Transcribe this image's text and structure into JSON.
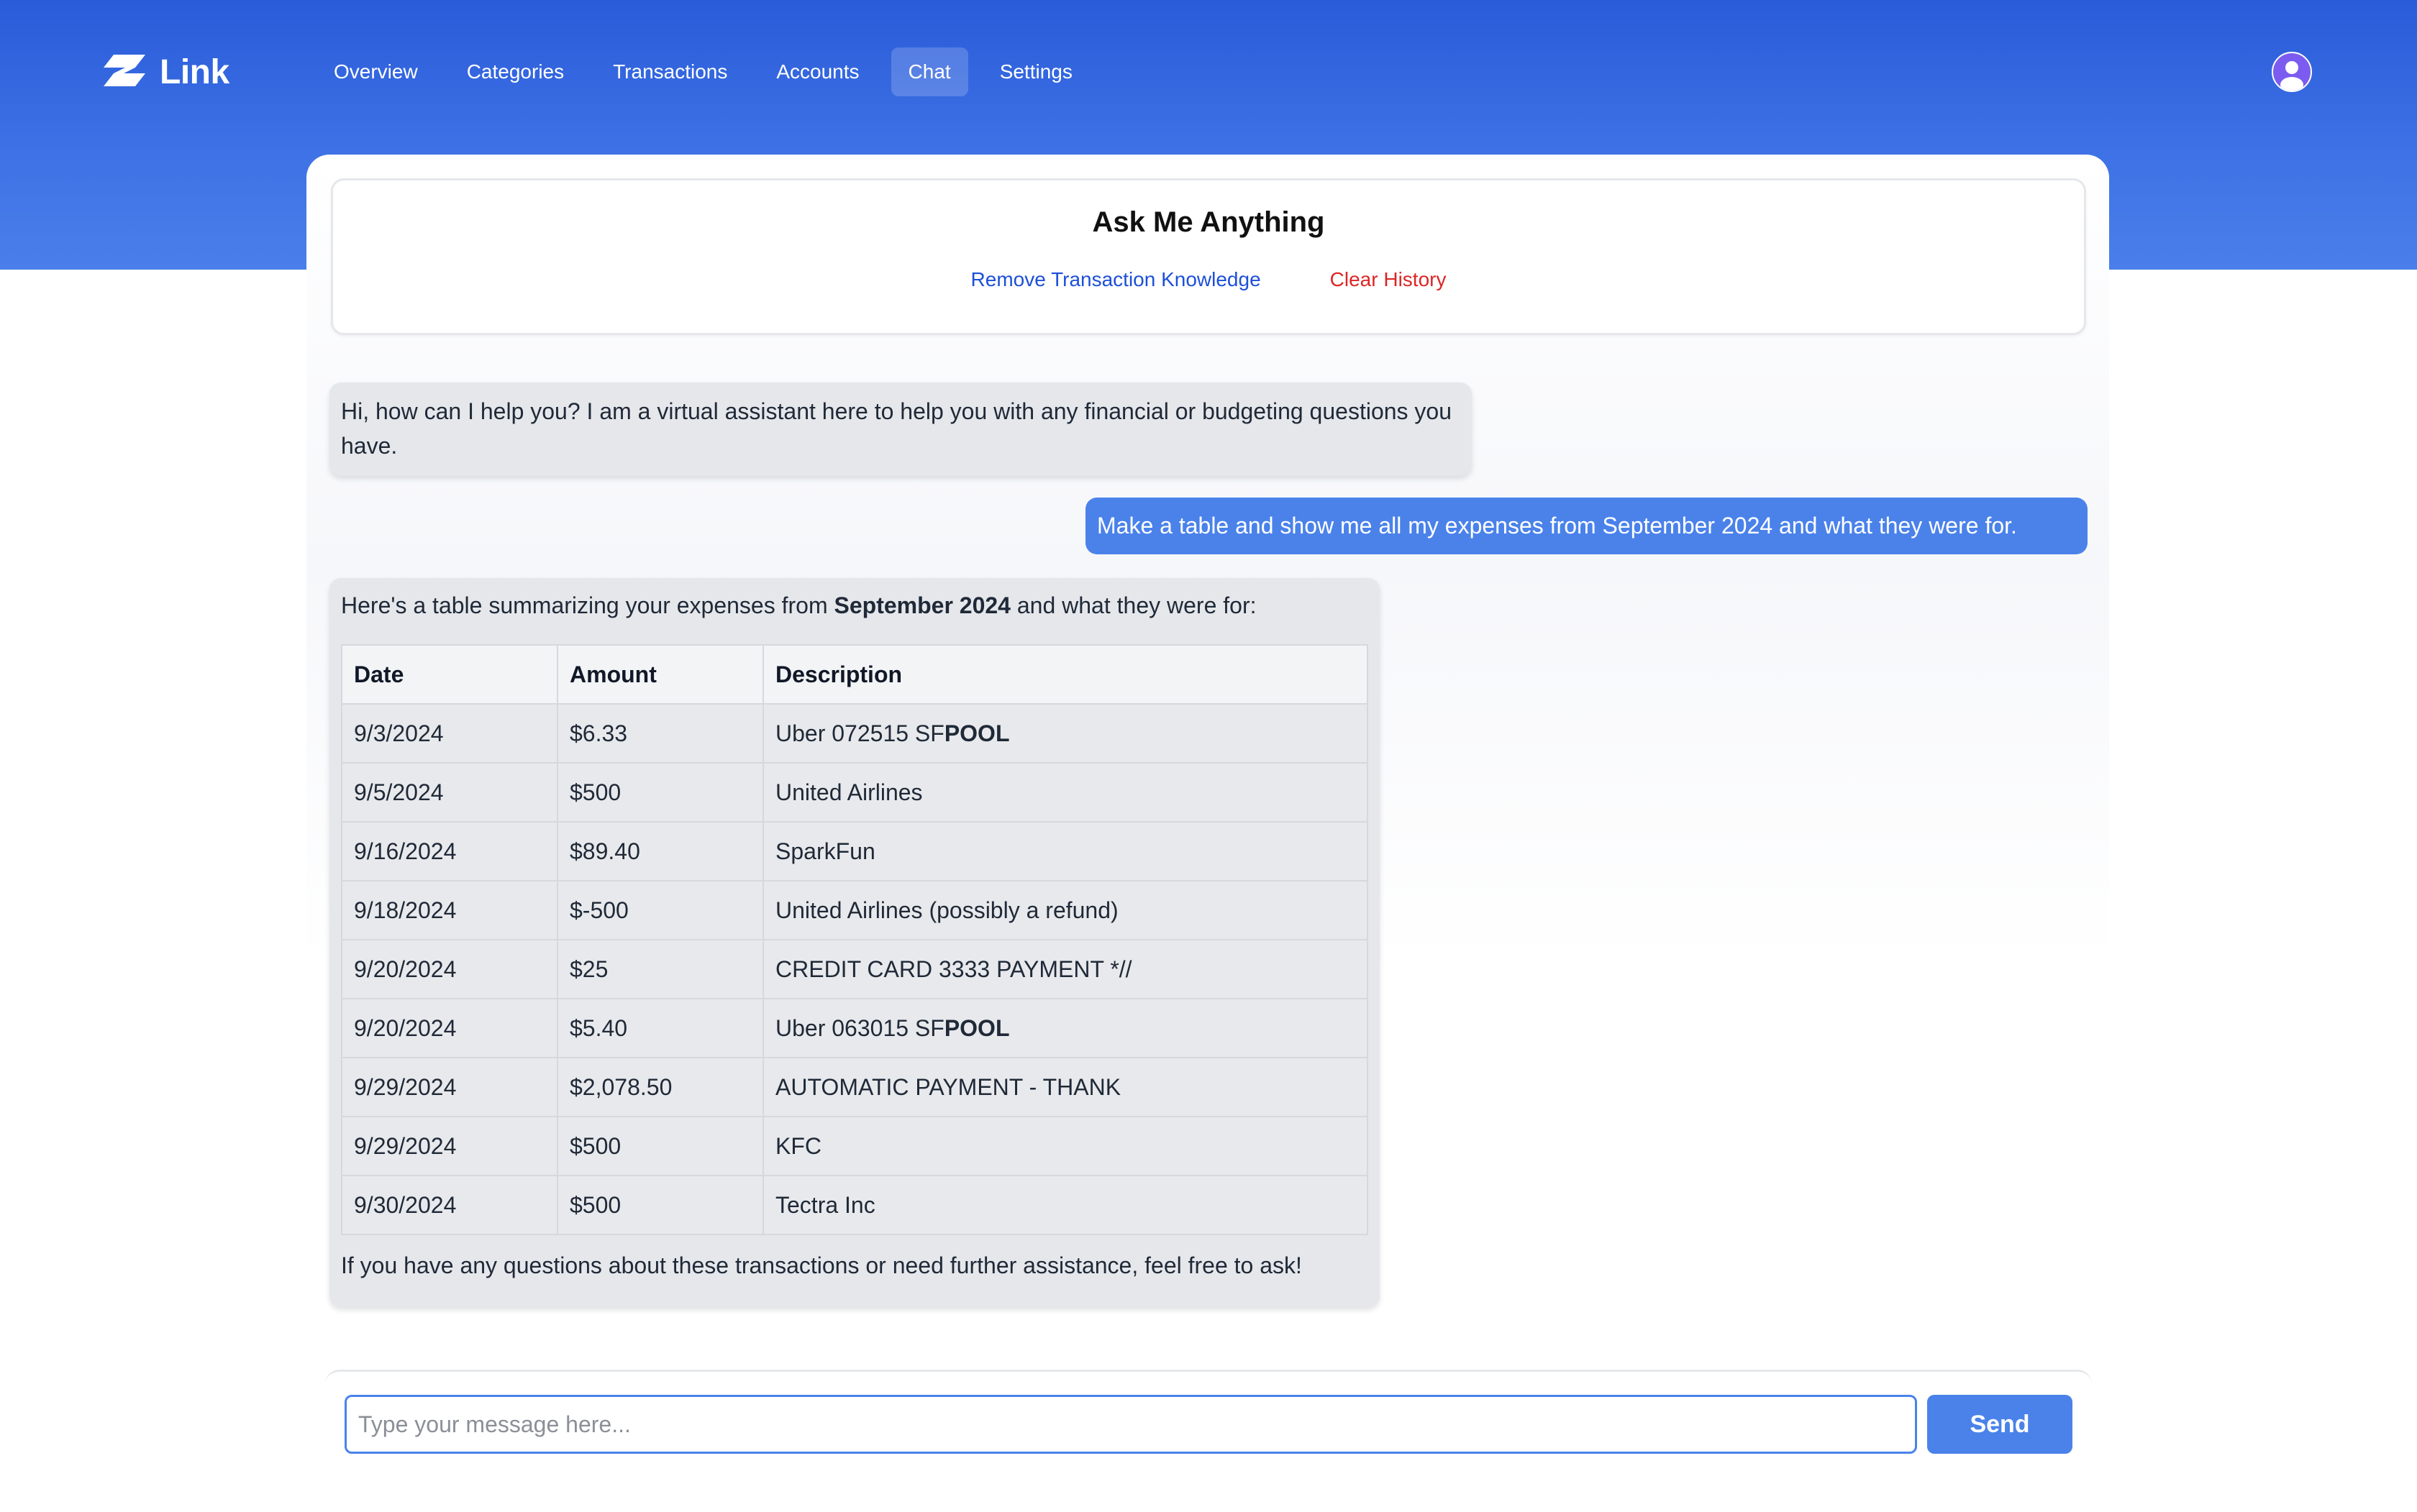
{
  "app": {
    "name": "Link"
  },
  "nav": {
    "items": [
      {
        "label": "Overview"
      },
      {
        "label": "Categories"
      },
      {
        "label": "Transactions"
      },
      {
        "label": "Accounts"
      },
      {
        "label": "Chat",
        "active": true
      },
      {
        "label": "Settings"
      }
    ]
  },
  "header": {
    "title": "Ask Me Anything",
    "remove_knowledge_label": "Remove Transaction Knowledge",
    "clear_history_label": "Clear History"
  },
  "messages": {
    "greeting": "Hi, how can I help you? I am a virtual assistant here to help you with any financial or budgeting questions you have.",
    "user_request": "Make a table and show me all my expenses from September 2024 and what they were for.",
    "reply": {
      "intro_before": "Here's a table summarizing your expenses from ",
      "intro_bold": "September 2024",
      "intro_after": " and what they were for:",
      "table": {
        "headers": [
          "Date",
          "Amount",
          "Description"
        ],
        "rows": [
          {
            "date": "9/3/2024",
            "amount": "$6.33",
            "desc": "Uber 072515 SF",
            "desc_bold": "POOL"
          },
          {
            "date": "9/5/2024",
            "amount": "$500",
            "desc": "United Airlines",
            "desc_bold": ""
          },
          {
            "date": "9/16/2024",
            "amount": "$89.40",
            "desc": "SparkFun",
            "desc_bold": ""
          },
          {
            "date": "9/18/2024",
            "amount": "$-500",
            "desc": "United Airlines (possibly a refund)",
            "desc_bold": ""
          },
          {
            "date": "9/20/2024",
            "amount": "$25",
            "desc": "CREDIT CARD 3333 PAYMENT *//",
            "desc_bold": ""
          },
          {
            "date": "9/20/2024",
            "amount": "$5.40",
            "desc": "Uber 063015 SF",
            "desc_bold": "POOL"
          },
          {
            "date": "9/29/2024",
            "amount": "$2,078.50",
            "desc": "AUTOMATIC PAYMENT - THANK",
            "desc_bold": ""
          },
          {
            "date": "9/29/2024",
            "amount": "$500",
            "desc": "KFC",
            "desc_bold": ""
          },
          {
            "date": "9/30/2024",
            "amount": "$500",
            "desc": "Tectra Inc",
            "desc_bold": ""
          }
        ]
      },
      "outro": "If you have any questions about these transactions or need further assistance, feel free to ask!"
    }
  },
  "composer": {
    "placeholder": "Type your message here...",
    "value": "",
    "send_label": "Send"
  },
  "colors": {
    "primary": "#4a82ea",
    "header_gradient_top": "#2a5bd9",
    "danger": "#dc2626",
    "link": "#1d4fd8",
    "avatar": "#7c5cf0"
  },
  "icons": {
    "logo": "link-logo-icon",
    "avatar": "user-avatar-icon"
  }
}
